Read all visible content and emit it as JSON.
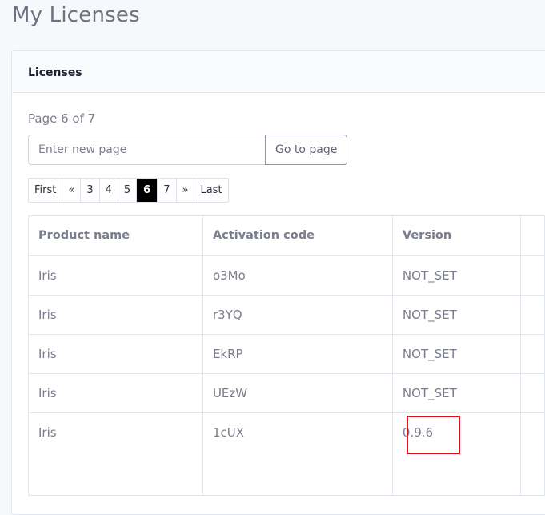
{
  "page": {
    "title": "My Licenses"
  },
  "card": {
    "title": "Licenses"
  },
  "pagination": {
    "page_info": "Page 6 of 7",
    "goto_placeholder": "Enter new page",
    "goto_value": "",
    "goto_button": "Go to page",
    "items": [
      {
        "label": "First",
        "active": false
      },
      {
        "label": "«",
        "active": false
      },
      {
        "label": "3",
        "active": false
      },
      {
        "label": "4",
        "active": false
      },
      {
        "label": "5",
        "active": false
      },
      {
        "label": "6",
        "active": true
      },
      {
        "label": "7",
        "active": false
      },
      {
        "label": "»",
        "active": false
      },
      {
        "label": "Last",
        "active": false
      }
    ]
  },
  "table": {
    "headers": {
      "product_name": "Product name",
      "activation_code": "Activation code",
      "version": "Version",
      "extra": ""
    },
    "rows": [
      {
        "product_name": "Iris",
        "activation_code": "o3Mo",
        "version": "NOT_SET"
      },
      {
        "product_name": "Iris",
        "activation_code": "r3YQ",
        "version": "NOT_SET"
      },
      {
        "product_name": "Iris",
        "activation_code": "EkRP",
        "version": "NOT_SET"
      },
      {
        "product_name": "Iris",
        "activation_code": "UEzW",
        "version": "NOT_SET"
      },
      {
        "product_name": "Iris",
        "activation_code": "1cUX",
        "version": "0.9.6"
      }
    ]
  },
  "colors": {
    "active_page_bg": "#000000",
    "highlight_border": "#e0101a"
  }
}
